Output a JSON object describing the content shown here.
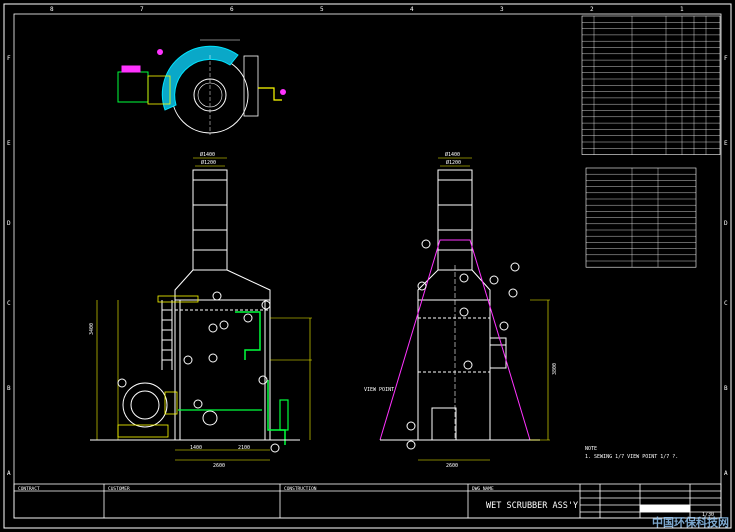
{
  "title_block": {
    "title": "WET SCRUBBER ASS'Y",
    "scale": "1/30",
    "cells": [
      "CONTRACT",
      "CUSTOMER",
      "CONSTRUCTION",
      "DWG NAME"
    ]
  },
  "note": {
    "heading": "NOTE",
    "line1": "1. SEWING 1/7 VIEW POINT 1/7 ?."
  },
  "dimensions": {
    "dia_top_left": "Ø1400",
    "dia_inner_left": "Ø1200",
    "dia_top_right": "Ø1400",
    "dia_inner_right": "Ø1200",
    "width_left": "2600",
    "sub_a": "1400",
    "sub_b": "2100",
    "width_right": "2600",
    "label_mid": "3400",
    "label_right": "3800"
  },
  "side_label": "VIEW POINT",
  "border_numbers": [
    "8",
    "7",
    "6",
    "5",
    "4",
    "3",
    "2",
    "1"
  ],
  "border_letters": [
    "F",
    "E",
    "D",
    "C",
    "B",
    "A"
  ],
  "colors": {
    "line": "#ffffff",
    "green": "#00ff3c",
    "cyan": "#00e5ff",
    "magenta": "#ff33ff",
    "yellow": "#ffff00"
  },
  "watermark": "中国环保科技网"
}
